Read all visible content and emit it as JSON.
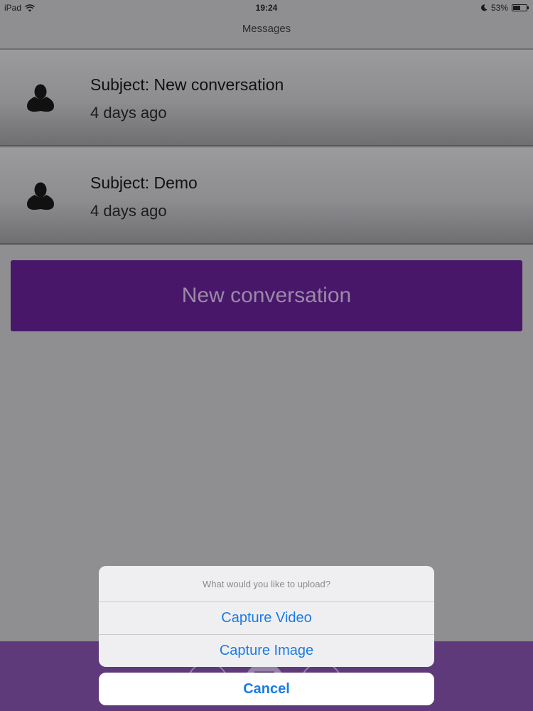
{
  "status_bar": {
    "device": "iPad",
    "time": "19:24",
    "battery": "53%",
    "battery_level_percent": 53
  },
  "nav": {
    "title": "Messages"
  },
  "messages": [
    {
      "subject": "Subject: New conversation",
      "time": "4 days ago"
    },
    {
      "subject": "Subject: Demo",
      "time": "4 days ago"
    }
  ],
  "new_conversation_button": "New conversation",
  "action_sheet": {
    "title": "What would you like to upload?",
    "options": [
      "Capture Video",
      "Capture Image"
    ],
    "cancel": "Cancel"
  },
  "colors": {
    "accent_purple": "#48176a",
    "ios_blue": "#1a7be6",
    "bottom_bar": "#5e3a7b"
  }
}
